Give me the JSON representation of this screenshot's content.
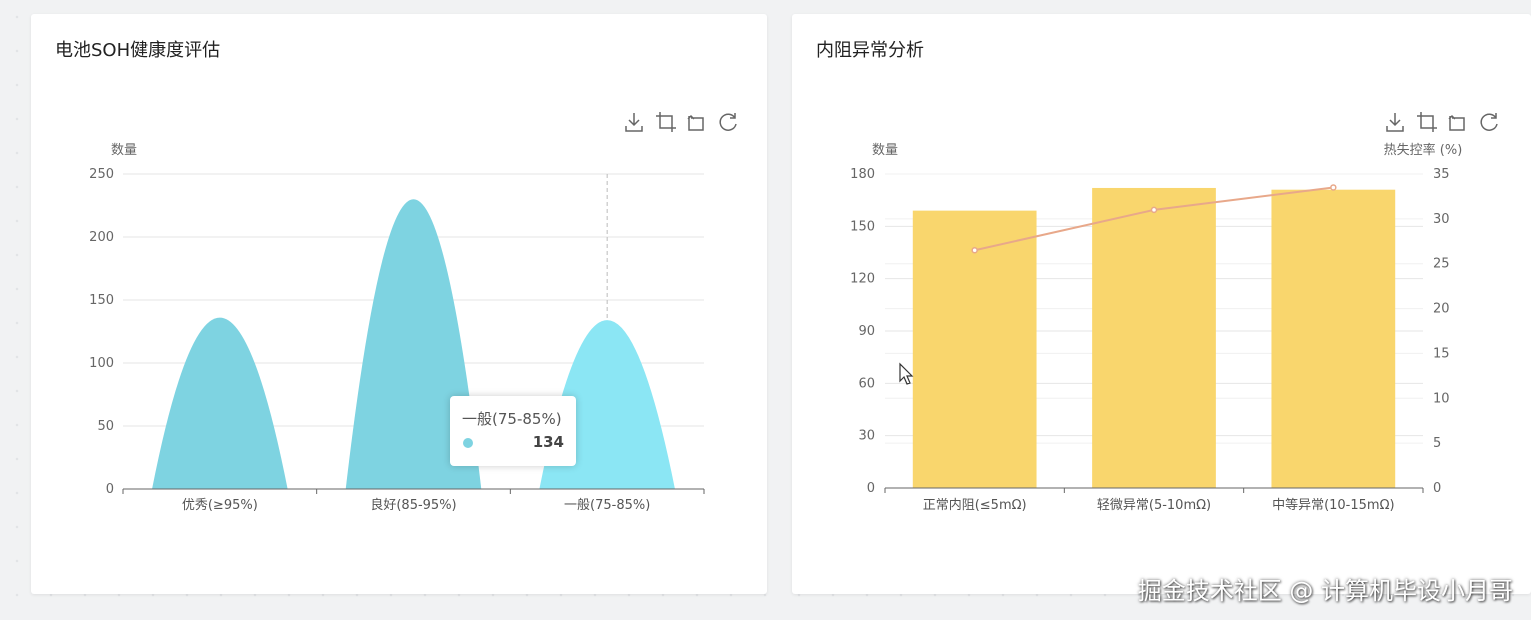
{
  "panels": {
    "left_title": "电池SOH健康度评估",
    "right_title": "内阻异常分析"
  },
  "toolbar_icons": [
    "download-icon",
    "zoom-icon",
    "zoom-reset-icon",
    "restore-icon"
  ],
  "tooltip": {
    "label": "一般(75-85%)",
    "value": "134"
  },
  "watermark": "掘金技术社区 @ 计算机毕设小月哥",
  "chart_data": [
    {
      "type": "bar",
      "shape": "pictorial-peak",
      "categories": [
        "优秀(≥95%)",
        "良好(85-95%)",
        "一般(75-85%)"
      ],
      "values": [
        136,
        230,
        134
      ],
      "ylabel": "数量",
      "ylim": [
        0,
        250
      ],
      "yticks": [
        0,
        50,
        100,
        150,
        200,
        250
      ],
      "grid": true,
      "highlighted_index": 2,
      "colors": {
        "bar": "#7ed3e1",
        "highlight": "#8be6f4"
      }
    },
    {
      "type": "bar+line",
      "categories": [
        "正常内阻(≤5mΩ)",
        "轻微异常(5-10mΩ)",
        "中等异常(10-15mΩ)"
      ],
      "series": [
        {
          "type": "bar",
          "values": [
            159,
            172,
            171
          ],
          "axis": "left",
          "color": "#f9d66d"
        },
        {
          "type": "line",
          "values": [
            26.5,
            31,
            33.5
          ],
          "axis": "right",
          "color": "#e8a88a"
        }
      ],
      "ylabel": "数量",
      "ylabel_right": "热失控率 (%)",
      "ylim": [
        0,
        180
      ],
      "yticks": [
        0,
        30,
        60,
        90,
        120,
        150,
        180
      ],
      "ylim_right": [
        0,
        35
      ],
      "yticks_right": [
        0,
        5,
        10,
        15,
        20,
        25,
        30,
        35
      ],
      "grid": true
    }
  ]
}
